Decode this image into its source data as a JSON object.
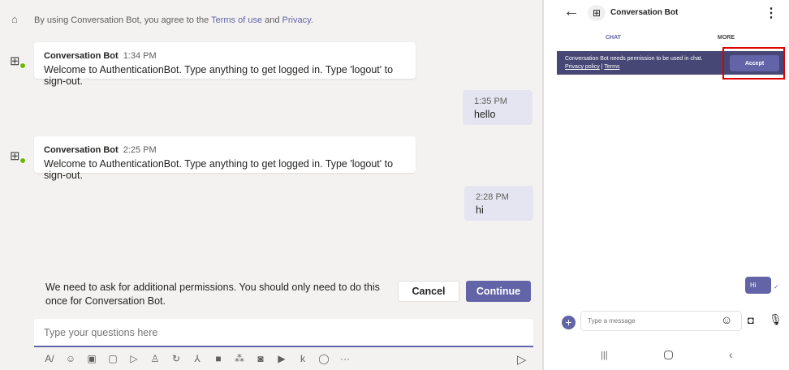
{
  "desktop": {
    "notice": {
      "prefix": "By using Conversation Bot, you agree to the ",
      "terms": "Terms of use",
      "and": " and ",
      "privacy": "Privacy",
      "suffix": "."
    },
    "messages": [
      {
        "sender": "Conversation Bot",
        "time": "1:34 PM",
        "text": "Welcome to AuthenticationBot. Type anything to get logged in. Type 'logout' to sign-out."
      },
      {
        "time": "1:35 PM",
        "text": "hello"
      },
      {
        "sender": "Conversation Bot",
        "time": "2:25 PM",
        "text": "Welcome to AuthenticationBot. Type anything to get logged in. Type 'logout' to sign-out."
      },
      {
        "time": "2:28 PM",
        "text": "hi"
      }
    ],
    "permission": {
      "text": "We need to ask for additional permissions. You should only need to do this once for Conversation Bot.",
      "cancel": "Cancel",
      "continue": "Continue"
    },
    "compose": {
      "placeholder": "Type your questions here",
      "more": "···"
    }
  },
  "mobile": {
    "title": "Conversation Bot",
    "tabs": [
      "CHAT",
      "MORE"
    ],
    "banner": {
      "text": "Conversation Bot needs permission to be used in chat.",
      "privacy": "Privacy policy",
      "sep": " | ",
      "terms": "Terms",
      "accept": "Accept"
    },
    "message": "Hi",
    "placeholder": "Type a message"
  },
  "colors": {
    "accent": "#6264a7",
    "banner": "#464775",
    "highlight": "#e00000"
  }
}
